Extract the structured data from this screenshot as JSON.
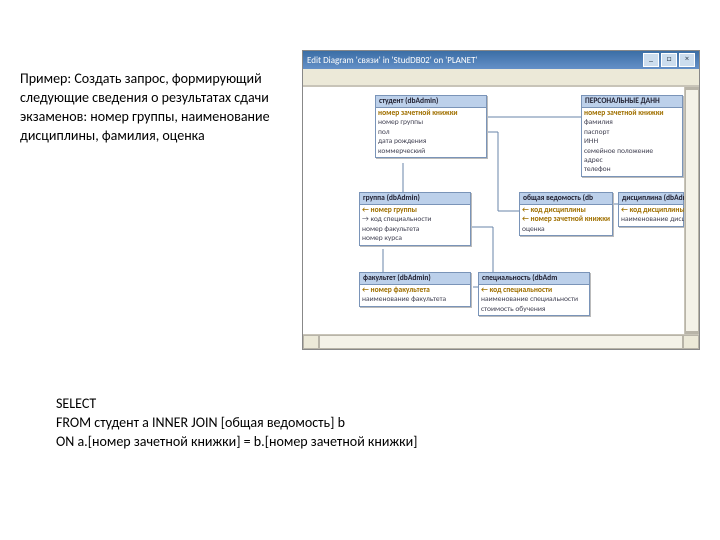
{
  "left_paragraph": "Пример: Создать запрос, формирующий следующие сведения о результатах сдачи экзаменов: номер группы, наименование дисциплины, фамилия, оценка",
  "sql": {
    "line1": "SELECT",
    "line2": "FROM   студент  a  INNER JOIN [общая ведомость]  b",
    "line3": "ON a.[номер зачетной книжки] = b.[номер зачетной книжки]"
  },
  "window": {
    "title": "Edit Diagram 'связи' in 'StudDB02' on 'PLANET'",
    "min": "_",
    "max": "□",
    "close": "×"
  },
  "tables": {
    "student": {
      "title": "студент (dbAdmin)",
      "rows": [
        "номер зачетной книжки",
        "номер группы",
        "пол",
        "дата рождения",
        "коммерческий"
      ]
    },
    "persdata": {
      "title": "ПЕРСОНАЛЬНЫЕ ДАНН",
      "rows": [
        "номер зачетной книжки",
        "фамилия",
        "паспорт",
        "ИНН",
        "семейное положение",
        "адрес",
        "телефон"
      ]
    },
    "group": {
      "title": "группа (dbAdmin)",
      "rows": [
        "← номер группы",
        "→ код специальности",
        "номер факультета",
        "номер курса"
      ]
    },
    "vedom": {
      "title": "общая ведомость (db",
      "rows": [
        "← код дисциплины",
        "← номер зачетной книжки",
        "оценка"
      ]
    },
    "disc": {
      "title": "дисциплина (dbAdmin)",
      "rows": [
        "← код дисциплины",
        "наименование дисциплины"
      ]
    },
    "fak": {
      "title": "факультет (dbAdmin)",
      "rows": [
        "← номер факультета",
        "наименование факультета"
      ]
    },
    "spec": {
      "title": "специальность (dbAdm",
      "rows": [
        "← код специальности",
        "наименование специальности",
        "стоимость обучения"
      ]
    }
  }
}
